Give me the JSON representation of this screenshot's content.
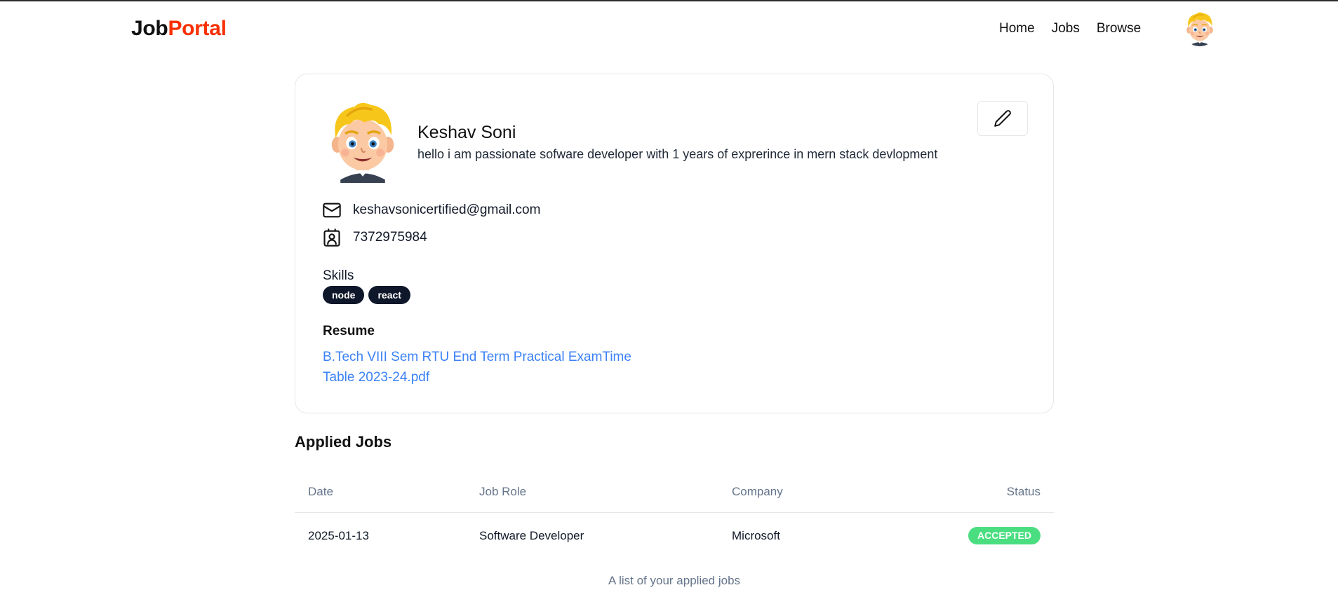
{
  "navbar": {
    "logo_part1": "Job",
    "logo_part2": "Portal",
    "links": [
      "Home",
      "Jobs",
      "Browse"
    ],
    "avatar_icon": "cartoon-boy-avatar"
  },
  "profile": {
    "name": "Keshav Soni",
    "bio": "hello i am passionate sofware developer with 1 years of exprerince in mern stack devlopment",
    "email": "keshavsonicertified@gmail.com",
    "phone": "7372975984",
    "skills_label": "Skills",
    "skills": [
      "node",
      "react"
    ],
    "resume_label": "Resume",
    "resume_file": "B.Tech VIII Sem RTU End Term Practical ExamTime Table 2023-24.pdf",
    "edit_icon": "pen-icon",
    "email_icon": "mail-icon",
    "phone_icon": "contact-icon"
  },
  "applied_jobs": {
    "title": "Applied Jobs",
    "columns": [
      "Date",
      "Job Role",
      "Company",
      "Status"
    ],
    "rows": [
      {
        "date": "2025-01-13",
        "role": "Software Developer",
        "company": "Microsoft",
        "status": "ACCEPTED"
      }
    ],
    "caption": "A list of your applied jobs"
  },
  "colors": {
    "brand": "#f83002",
    "badge": "#0f172a",
    "link": "#3b82f6",
    "status_accepted": "#4ade80"
  }
}
